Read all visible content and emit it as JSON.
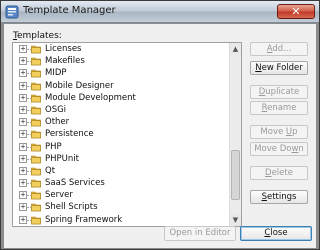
{
  "window": {
    "title": "Template Manager",
    "close_label": "✕"
  },
  "colors": {
    "folder": "#e3b53d",
    "titlebar": "#b8c4d0",
    "close": "#c0392b"
  },
  "tree": {
    "label_prefix": "",
    "label_mnemonic": "T",
    "label_rest": "emplates:",
    "items": [
      {
        "label": "Licenses"
      },
      {
        "label": "Makefiles"
      },
      {
        "label": "MIDP"
      },
      {
        "label": "Mobile Designer"
      },
      {
        "label": "Module Development"
      },
      {
        "label": "OSGi"
      },
      {
        "label": "Other"
      },
      {
        "label": "Persistence"
      },
      {
        "label": "PHP"
      },
      {
        "label": "PHPUnit"
      },
      {
        "label": "Qt"
      },
      {
        "label": "SaaS Services"
      },
      {
        "label": "Server"
      },
      {
        "label": "Shell Scripts"
      },
      {
        "label": "Spring Framework"
      }
    ]
  },
  "buttons": {
    "add": {
      "pre": "",
      "key": "A",
      "post": "dd..."
    },
    "new_folder": {
      "pre": "",
      "key": "N",
      "post": "ew Folder"
    },
    "duplicate": {
      "pre": "",
      "key": "D",
      "post": "uplicate"
    },
    "rename": {
      "pre": "",
      "key": "R",
      "post": "ename"
    },
    "move_up": {
      "pre": "Move ",
      "key": "U",
      "post": "p"
    },
    "move_down": {
      "pre": "Move Do",
      "key": "w",
      "post": "n"
    },
    "delete": {
      "pre": "",
      "key": "D",
      "post": "elete"
    },
    "settings": {
      "pre": "",
      "key": "S",
      "post": "ettings"
    },
    "open_in_editor": "Open in Editor",
    "close": {
      "pre": "",
      "key": "C",
      "post": "lose"
    }
  }
}
